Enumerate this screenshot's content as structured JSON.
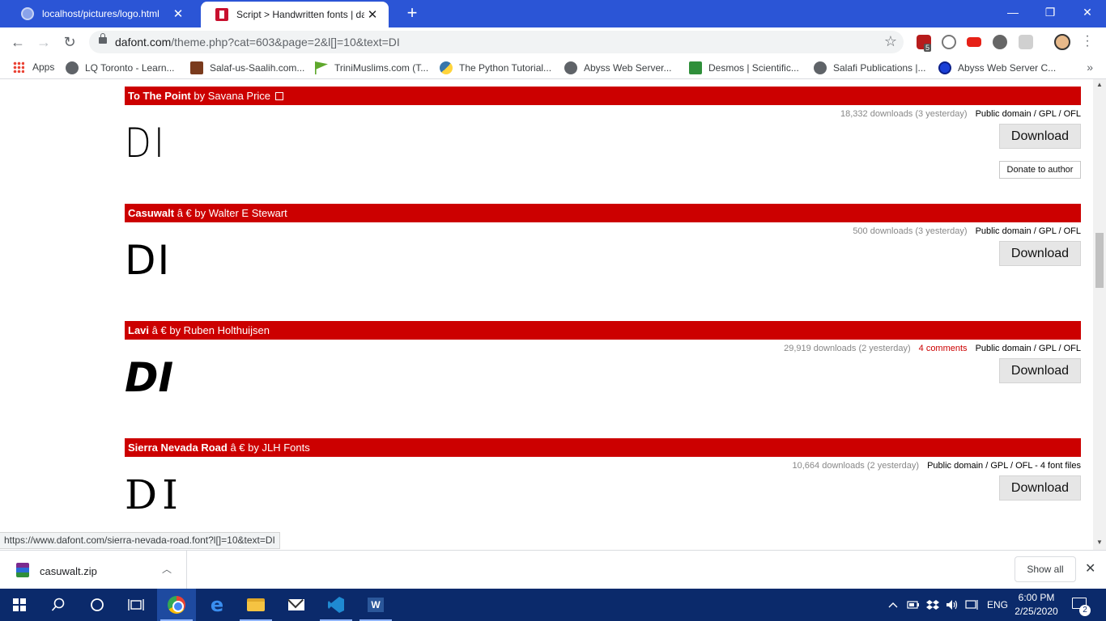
{
  "browser": {
    "tabs": [
      {
        "title": "localhost/pictures/logo.html",
        "close": "✕"
      },
      {
        "title": "Script > Handwritten fonts | dafont",
        "close": "✕"
      }
    ],
    "new_tab": "+",
    "window_controls": {
      "minimize": "—",
      "restore": "❐",
      "close": "✕"
    },
    "url_host": "dafont.com",
    "url_path": "/theme.php?cat=603&page=2&l[]=10&text=DI",
    "extension_badge": "5",
    "nav": {
      "back": "←",
      "forward": "→",
      "reload": "↻"
    },
    "star": "☆"
  },
  "bookmarks": {
    "items": [
      {
        "label": "Apps"
      },
      {
        "label": "LQ Toronto - Learn..."
      },
      {
        "label": "Salaf-us-Saalih.com..."
      },
      {
        "label": "TriniMuslims.com (T..."
      },
      {
        "label": "The Python Tutorial..."
      },
      {
        "label": "Abyss Web Server..."
      },
      {
        "label": "Desmos | Scientific..."
      },
      {
        "label": "Salafi Publications |..."
      },
      {
        "label": "Abyss Web Server C..."
      }
    ],
    "more": "»"
  },
  "fonts": [
    {
      "name": "To The Point",
      "by": "by Savana Price",
      "marker": "",
      "downloads": "18,332 downloads (3 yesterday)",
      "comments": "",
      "license": "Public domain / GPL / OFL",
      "preview": "DI",
      "download_label": "Download",
      "donate_label": "Donate to author"
    },
    {
      "name": "Casuwalt",
      "by": "by Walter E Stewart",
      "marker": "â €",
      "downloads": "500 downloads (3 yesterday)",
      "comments": "",
      "license": "Public domain / GPL / OFL",
      "preview": "DI",
      "download_label": "Download"
    },
    {
      "name": "Lavi",
      "by": "by Ruben Holthuijsen",
      "marker": "â €",
      "downloads": "29,919 downloads (2 yesterday)",
      "comments": "4 comments",
      "license": "Public domain / GPL / OFL",
      "preview": "DI",
      "download_label": "Download"
    },
    {
      "name": "Sierra Nevada Road",
      "by": "by JLH Fonts",
      "marker": "â €",
      "downloads": "10,664 downloads (2 yesterday)",
      "comments": "",
      "license": "Public domain / GPL / OFL - 4 font files",
      "preview": "DI",
      "download_label": "Download"
    }
  ],
  "status_url": "https://www.dafont.com/sierra-nevada-road.font?l[]=10&text=DI",
  "downloads_shelf": {
    "file": "casuwalt.zip",
    "show_all": "Show all",
    "close": "✕",
    "chevron": "︿"
  },
  "taskbar": {
    "language": "ENG",
    "time": "6:00 PM",
    "date": "2/25/2020",
    "notification_count": "2",
    "word_letter": "W",
    "edge_letter": "e"
  },
  "colors": {
    "tabstrip": "#2b55d6",
    "font_header": "#cc0000",
    "taskbar": "#0b2a6b"
  }
}
